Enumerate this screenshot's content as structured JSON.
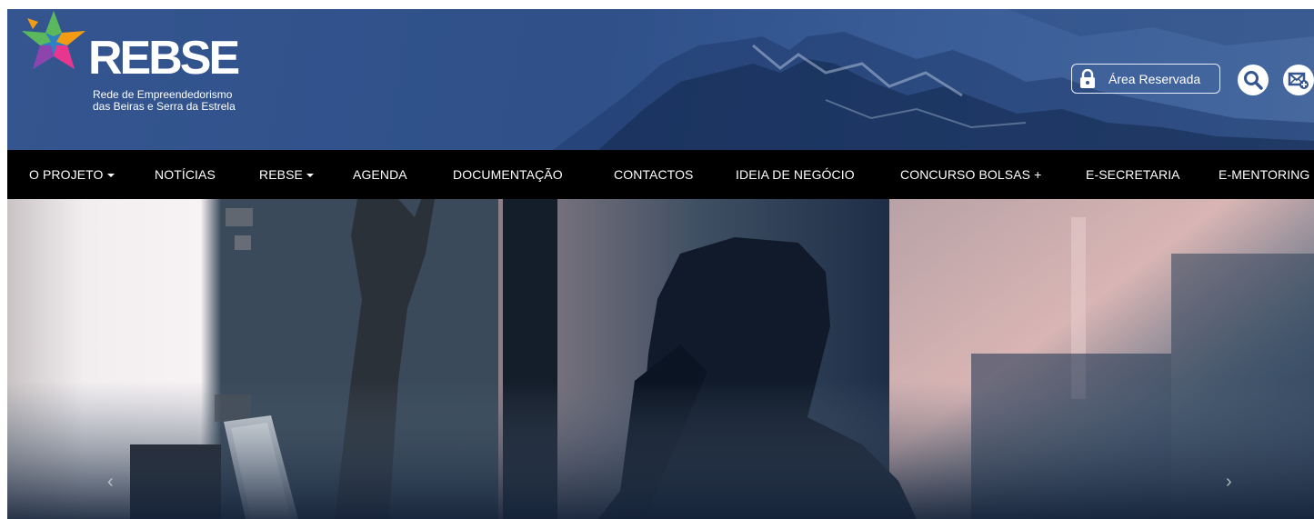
{
  "brand": {
    "name": "REBSE",
    "tagline_line1": "Rede de Empreendedorismo",
    "tagline_line2": "das Beiras e Serra da Estrela",
    "colors": {
      "header_blue": "#34558f",
      "nav_black": "#000000",
      "star_green": "#5cb85c",
      "star_orange": "#f39c12",
      "star_pink": "#e8368f",
      "star_blue": "#2f80c2",
      "star_purple": "#8e44ad"
    }
  },
  "header": {
    "area_reservada_label": "Área Reservada",
    "lock_icon": "lock-icon",
    "search_icon": "search-icon",
    "newsletter_icon": "mail-add-icon"
  },
  "nav": {
    "items": [
      {
        "label": "O PROJETO",
        "dropdown": true
      },
      {
        "label": "NOTÍCIAS",
        "dropdown": false
      },
      {
        "label": "REBSE",
        "dropdown": true
      },
      {
        "label": "AGENDA",
        "dropdown": false
      },
      {
        "label": "DOCUMENTAÇÃO",
        "dropdown": false
      },
      {
        "label": "CONTACTOS",
        "dropdown": false
      },
      {
        "label": "IDEIA DE NEGÓCIO",
        "dropdown": false
      },
      {
        "label": "CONCURSO BOLSAS +",
        "dropdown": false
      },
      {
        "label": "E-SECRETARIA",
        "dropdown": false
      },
      {
        "label": "E-MENTORING",
        "dropdown": false
      }
    ]
  },
  "carousel": {
    "prev_glyph": "‹",
    "next_glyph": "›"
  }
}
